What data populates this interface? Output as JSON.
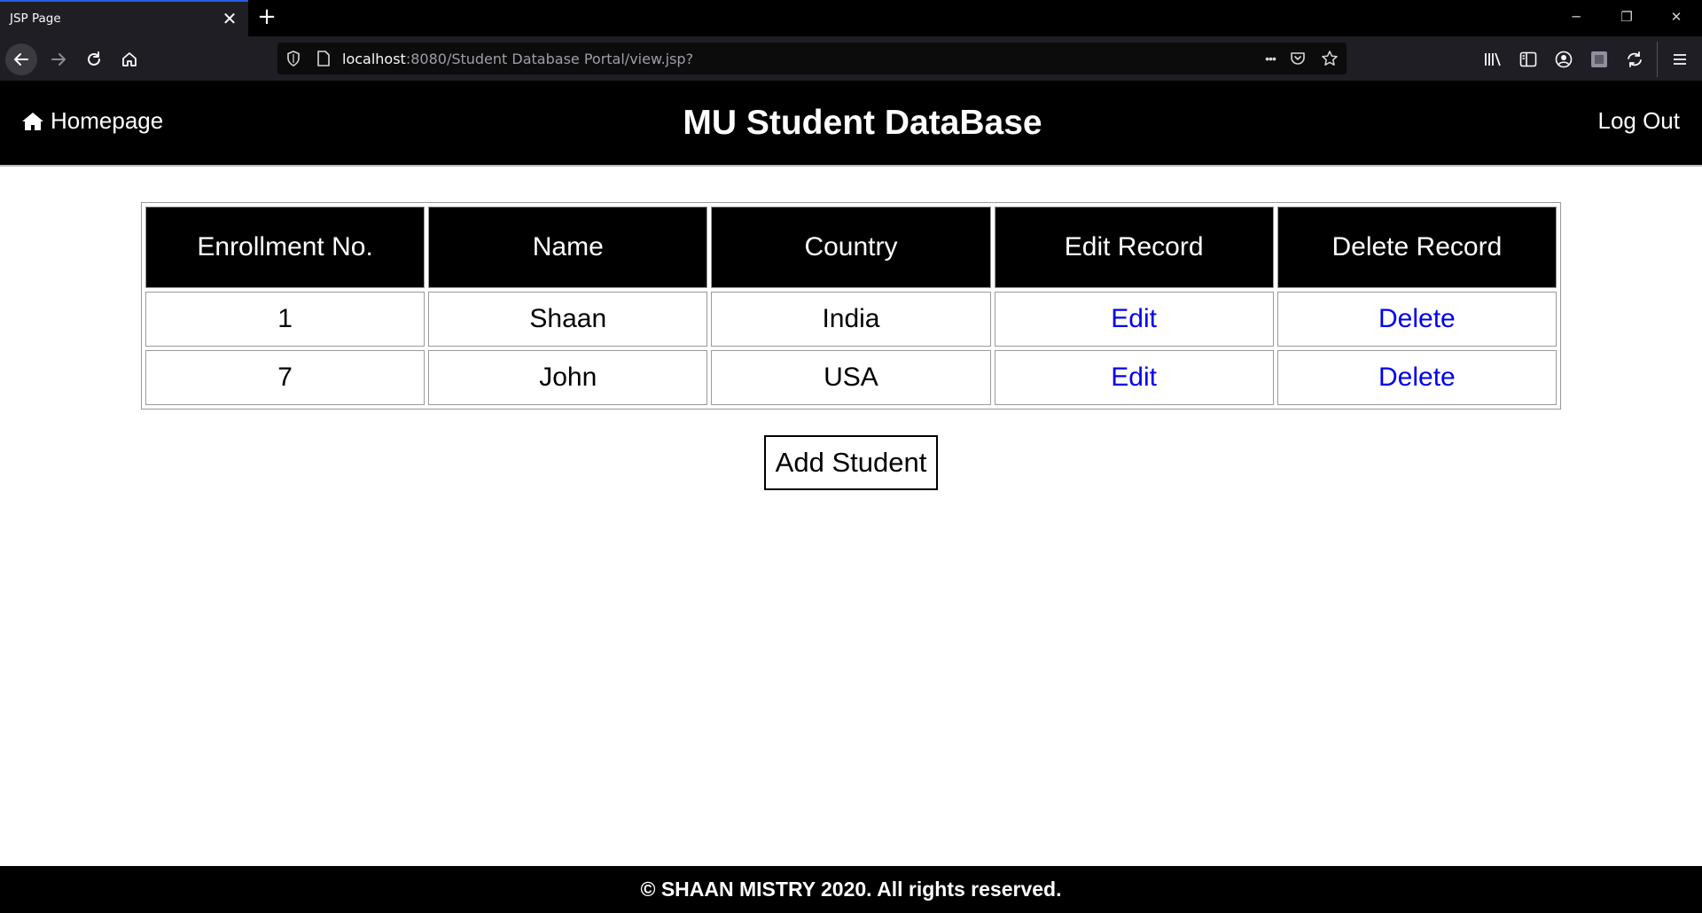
{
  "browser": {
    "tab_title": "JSP Page",
    "tab_close": "✕",
    "new_tab": "+",
    "url_host": "localhost",
    "url_path": ":8080/Student Database Portal/view.jsp?",
    "url_more": "•••",
    "window_minimize": "─",
    "window_restore": "❐",
    "window_close": "✕"
  },
  "header": {
    "home_label": "Homepage",
    "title": "MU Student DataBase",
    "logout_label": "Log Out"
  },
  "table": {
    "columns": [
      "Enrollment No.",
      "Name",
      "Country",
      "Edit Record",
      "Delete Record"
    ],
    "rows": [
      {
        "enrollment": "1",
        "name": "Shaan",
        "country": "India",
        "edit": "Edit",
        "delete": "Delete"
      },
      {
        "enrollment": "7",
        "name": "John",
        "country": "USA",
        "edit": "Edit",
        "delete": "Delete"
      }
    ]
  },
  "actions": {
    "add_student_label": "Add Student"
  },
  "footer": {
    "text": "© SHAAN MISTRY 2020. All rights reserved."
  },
  "colors": {
    "header_bg": "#000000",
    "link": "#0000ee",
    "tab_accent": "#2a5ce0"
  },
  "icons": {
    "home": "home-icon",
    "back": "back-arrow-icon",
    "forward": "forward-arrow-icon",
    "reload": "reload-icon",
    "browser_home": "browser-home-icon",
    "shield": "shield-icon",
    "page": "page-icon",
    "pocket": "pocket-icon",
    "bookmark": "star-icon",
    "library": "library-icon",
    "sidebar": "sidebar-icon",
    "account": "account-icon",
    "extension": "extension-icon",
    "sync": "sync-icon",
    "menu": "hamburger-menu-icon"
  }
}
